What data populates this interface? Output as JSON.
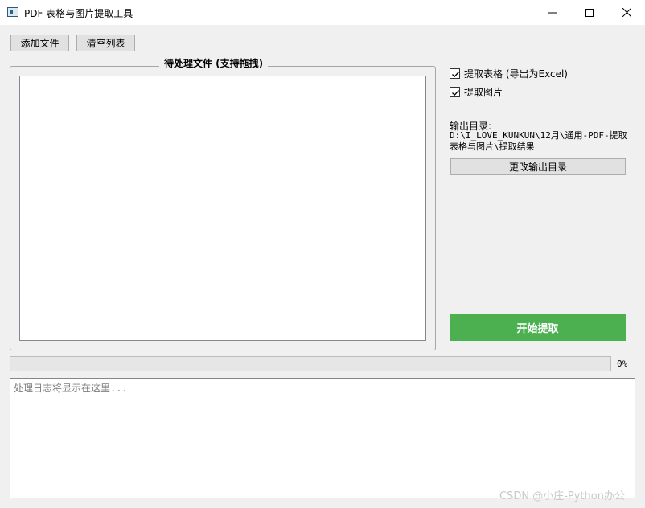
{
  "window": {
    "title": "PDF 表格与图片提取工具",
    "controls": {
      "minimize": "minimize-icon",
      "maximize": "maximize-icon",
      "close": "close-icon"
    }
  },
  "toolbar": {
    "add_label": "添加文件",
    "clear_label": "清空列表"
  },
  "file_group": {
    "title": "待处理文件 (支持拖拽)",
    "items": []
  },
  "options": {
    "extract_tables": {
      "label": "提取表格 (导出为Excel)",
      "checked": true
    },
    "extract_images": {
      "label": "提取图片",
      "checked": true
    }
  },
  "output": {
    "label": "输出目录:",
    "path": "D:\\I_LOVE_KUNKUN\\12月\\通用-PDF-提取表格与图片\\提取结果",
    "change_label": "更改输出目录"
  },
  "start": {
    "label": "开始提取",
    "color": "#4caf50"
  },
  "progress": {
    "value": 0,
    "text": "0%"
  },
  "log": {
    "placeholder": "处理日志将显示在这里..."
  },
  "watermark": "CSDN @小庄-Python办公"
}
